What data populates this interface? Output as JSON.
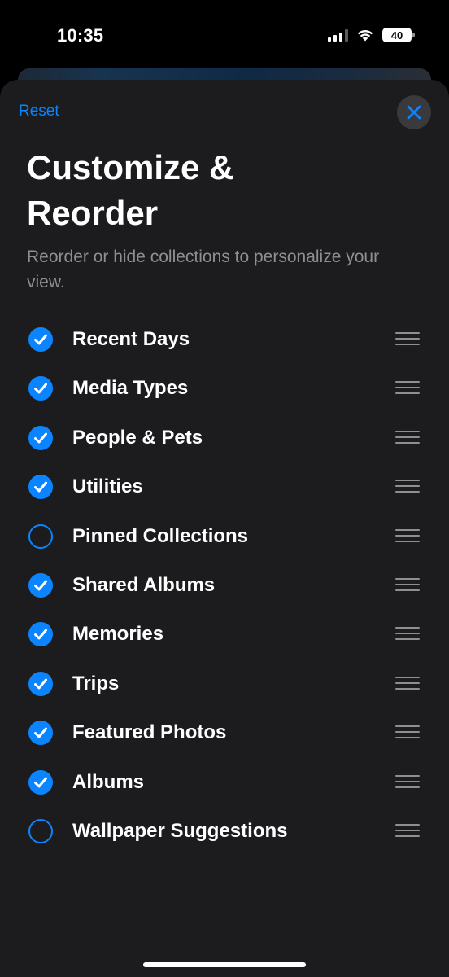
{
  "status_bar": {
    "time": "10:35",
    "battery": "40"
  },
  "header": {
    "reset_label": "Reset",
    "close_icon": "close-icon",
    "title": "Customize & Reorder",
    "subtitle": "Reorder or hide collections to personalize your view."
  },
  "collections": [
    {
      "label": "Recent Days",
      "checked": true
    },
    {
      "label": "Media Types",
      "checked": true
    },
    {
      "label": "People & Pets",
      "checked": true
    },
    {
      "label": "Utilities",
      "checked": true
    },
    {
      "label": "Pinned Collections",
      "checked": false
    },
    {
      "label": "Shared Albums",
      "checked": true
    },
    {
      "label": "Memories",
      "checked": true
    },
    {
      "label": "Trips",
      "checked": true
    },
    {
      "label": "Featured Photos",
      "checked": true
    },
    {
      "label": "Albums",
      "checked": true
    },
    {
      "label": "Wallpaper Suggestions",
      "checked": false
    }
  ],
  "colors": {
    "accent": "#0a84ff",
    "sheet_background": "#1c1c1e",
    "secondary_text": "#8e8e93"
  }
}
